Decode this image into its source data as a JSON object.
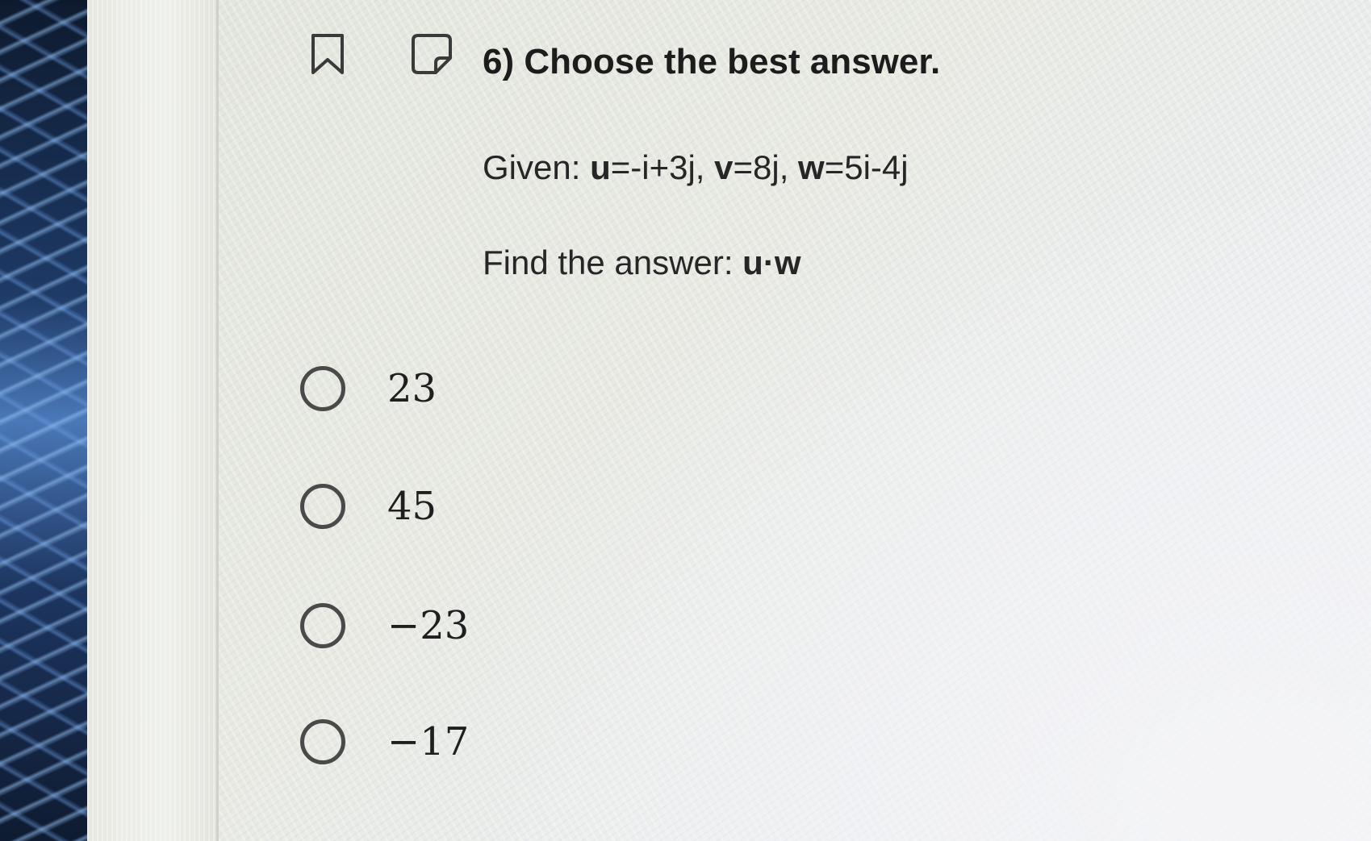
{
  "question": {
    "title": "6) Choose the best answer.",
    "given_prefix": "Given: ",
    "given_u": "u",
    "given_u_def": "=-i+3j, ",
    "given_v": "v",
    "given_v_def": "=8j, ",
    "given_w": "w",
    "given_w_def": "=5i-4j",
    "find_prefix": "Find the answer: ",
    "find_expr": "u·w"
  },
  "options": [
    {
      "label": "23",
      "selected": false
    },
    {
      "label": "45",
      "selected": false
    },
    {
      "label": "−23",
      "selected": false
    },
    {
      "label": "−17",
      "selected": false
    }
  ],
  "icons": {
    "bookmark": "bookmark-icon",
    "note": "note-icon"
  },
  "colors": {
    "text": "#1c1c1c",
    "radio_border": "#4a4a4a"
  }
}
